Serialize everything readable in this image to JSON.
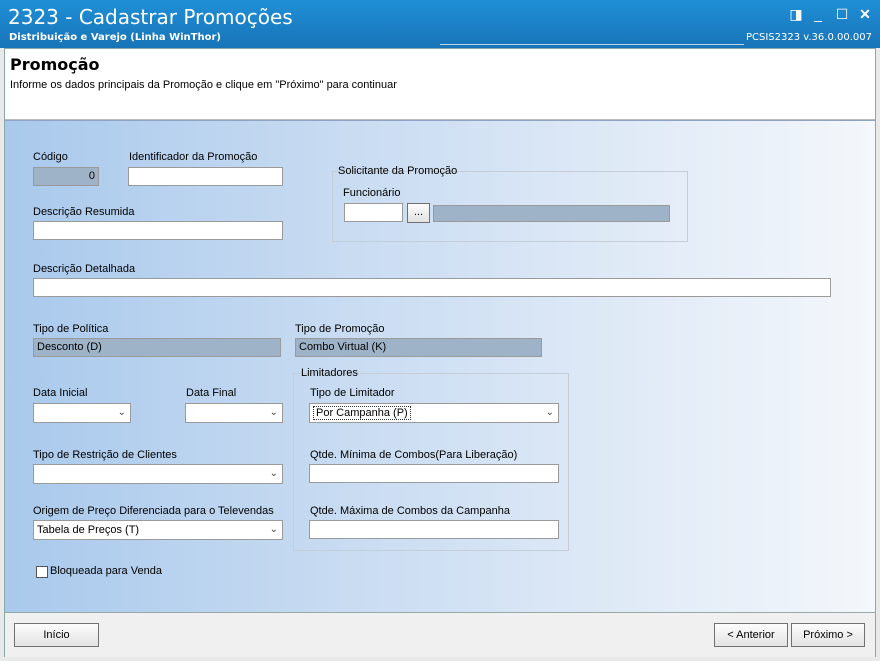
{
  "window": {
    "title": "2323 - Cadastrar Promoções",
    "subtitle": "Distribuição e Varejo (Linha WinThor)",
    "version": "PCSIS2323  v.36.0.00.007"
  },
  "header": {
    "title": "Promoção",
    "instruction": "Informe os dados principais da Promoção e clique em \"Próximo\" para continuar"
  },
  "form": {
    "codigo": {
      "label": "Código",
      "value": "0"
    },
    "identificador": {
      "label": "Identificador da Promoção",
      "value": ""
    },
    "descricao_resumida": {
      "label": "Descrição Resumida",
      "value": ""
    },
    "descricao_detalhada": {
      "label": "Descrição Detalhada",
      "value": ""
    },
    "solicitante": {
      "group_title": "Solicitante da Promoção",
      "funcionario_label": "Funcionário",
      "funcionario_code": "",
      "lookup_button": "...",
      "funcionario_name": ""
    },
    "tipo_politica": {
      "label": "Tipo de Política",
      "value": "Desconto (D)"
    },
    "tipo_promocao": {
      "label": "Tipo de Promoção",
      "value": "Combo Virtual (K)"
    },
    "data_inicial": {
      "label": "Data Inicial",
      "value": ""
    },
    "data_final": {
      "label": "Data Final",
      "value": ""
    },
    "tipo_restricao": {
      "label": "Tipo de Restrição de Clientes",
      "value": ""
    },
    "origem_preco": {
      "label": "Origem de Preço Diferenciada para o Televendas",
      "value": "Tabela de Preços (T)"
    },
    "limitadores": {
      "group_title": "Limitadores",
      "tipo_limitador_label": "Tipo de Limitador",
      "tipo_limitador_value": "Por Campanha (P)",
      "qtd_minima_label": "Qtde. Mínima de Combos(Para Liberação)",
      "qtd_minima_value": "",
      "qtd_maxima_label": "Qtde. Máxima de Combos da Campanha",
      "qtd_maxima_value": ""
    },
    "bloqueada": {
      "label": "Bloqueada para Venda",
      "checked": false
    }
  },
  "footer": {
    "inicio": "Início",
    "anterior": "< Anterior",
    "proximo": "Próximo >"
  }
}
